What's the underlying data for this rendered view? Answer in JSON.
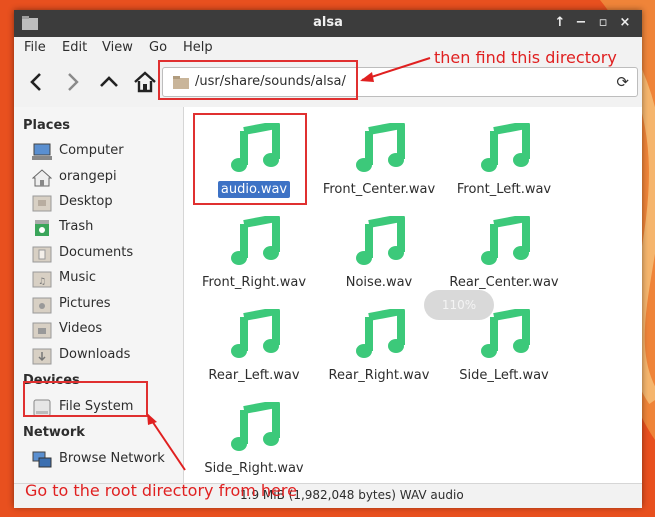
{
  "window": {
    "title": "alsa"
  },
  "title_controls": [
    {
      "icon": "arrow-up-icon",
      "glyph": "↑"
    },
    {
      "icon": "minimize-icon",
      "glyph": "−"
    },
    {
      "icon": "maximize-icon",
      "glyph": "▫"
    },
    {
      "icon": "close-icon",
      "glyph": "×"
    }
  ],
  "menu": [
    "File",
    "Edit",
    "View",
    "Go",
    "Help"
  ],
  "location": {
    "path": "/usr/share/sounds/alsa/"
  },
  "sidebar": {
    "places_title": "Places",
    "places": [
      {
        "label": "Computer",
        "icon": "computer-icon"
      },
      {
        "label": "orangepi",
        "icon": "home-icon"
      },
      {
        "label": "Desktop",
        "icon": "desktop-folder-icon"
      },
      {
        "label": "Trash",
        "icon": "trash-icon"
      },
      {
        "label": "Documents",
        "icon": "documents-folder-icon"
      },
      {
        "label": "Music",
        "icon": "music-folder-icon"
      },
      {
        "label": "Pictures",
        "icon": "pictures-folder-icon"
      },
      {
        "label": "Videos",
        "icon": "videos-folder-icon"
      },
      {
        "label": "Downloads",
        "icon": "downloads-folder-icon"
      }
    ],
    "devices_title": "Devices",
    "devices": [
      {
        "label": "File System",
        "icon": "drive-icon"
      }
    ],
    "network_title": "Network",
    "network": [
      {
        "label": "Browse Network",
        "icon": "network-icon"
      }
    ]
  },
  "files": [
    {
      "name": "audio.wav",
      "selected": true
    },
    {
      "name": "Front_Center.wav"
    },
    {
      "name": "Front_Left.wav"
    },
    {
      "name": "Front_Right.wav"
    },
    {
      "name": "Noise.wav"
    },
    {
      "name": "Rear_Center.wav"
    },
    {
      "name": "Rear_Left.wav"
    },
    {
      "name": "Rear_Right.wav"
    },
    {
      "name": "Side_Left.wav"
    },
    {
      "name": "Side_Right.wav"
    }
  ],
  "zoom_label": "110%",
  "status": "1.9 MiB (1,982,048 bytes) WAV audio",
  "annotations": {
    "top_note": "then find this directory",
    "bottom_note": "Go to the root directory from here"
  },
  "colors": {
    "accent": "#3d72c5",
    "annotation": "#e02020",
    "music_icon": "#3cc97a",
    "titlebar": "#3c3c3c",
    "desktop": "#e8501f"
  }
}
